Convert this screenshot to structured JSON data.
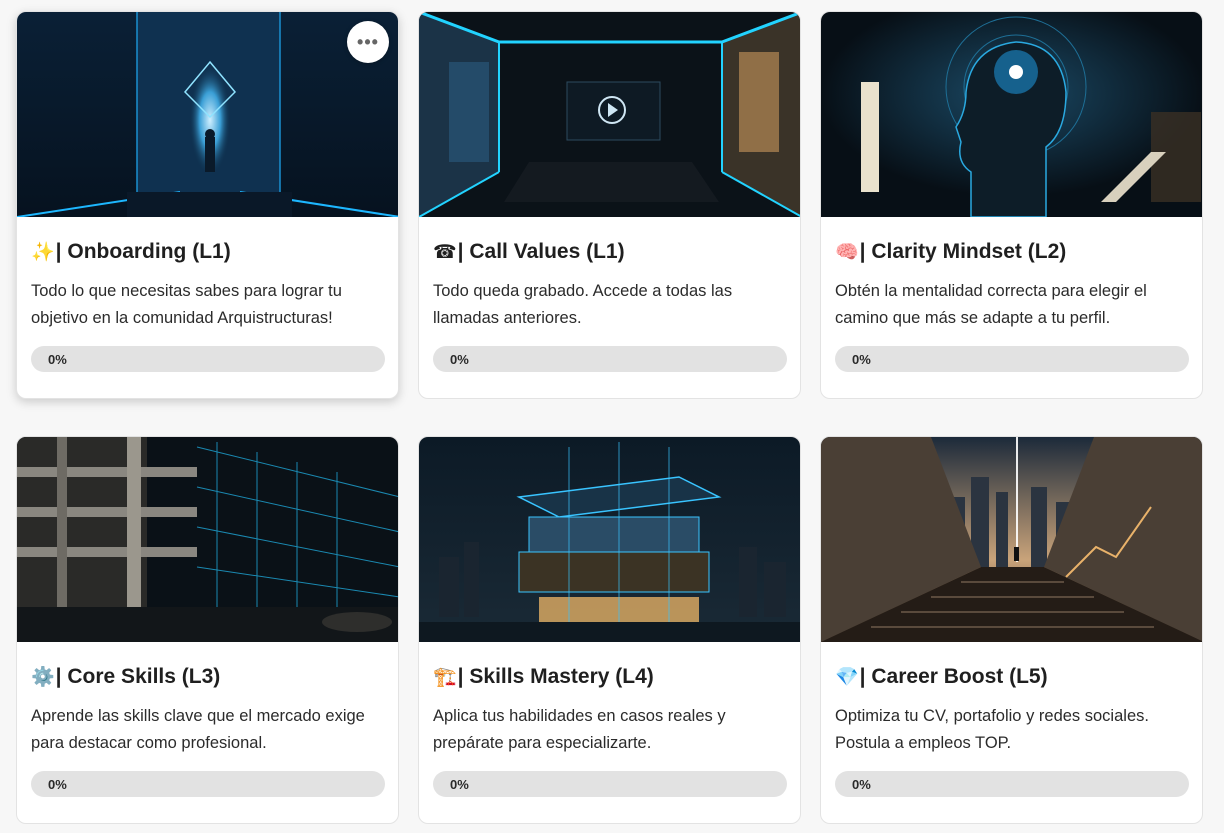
{
  "courses": [
    {
      "emoji": "✨",
      "title": "| Onboarding (L1)",
      "description": "Todo lo que necesitas sabes para lograr tu objetivo en la comunidad Arquistructuras!",
      "progress_label": "0%",
      "progress": 0,
      "image": "futuristic-corridor-figure",
      "menu_icon": "ellipsis-icon"
    },
    {
      "emoji": "☎",
      "title": "| Call Values (L1)",
      "description": "Todo queda grabado. Accede a todas las llamadas anteriores.",
      "progress_label": "0%",
      "progress": 0,
      "image": "meeting-room-play"
    },
    {
      "emoji": "🧠",
      "title": "| Clarity Mindset (L2)",
      "description": "Obtén la mentalidad correcta para elegir el camino que más se adapte a tu perfil.",
      "progress_label": "0%",
      "progress": 0,
      "image": "glowing-brain-head"
    },
    {
      "emoji": "⚙️",
      "title": "| Core Skills (L3)",
      "description": "Aprende las skills clave que el mercado exige para destacar como profesional.",
      "progress_label": "0%",
      "progress": 0,
      "image": "concrete-building-wireframe"
    },
    {
      "emoji": "🏗️",
      "title": "| Skills Mastery (L4)",
      "description": "Aplica tus habilidades en casos reales y prepárate para especializarte.",
      "progress_label": "0%",
      "progress": 0,
      "image": "glass-house-night"
    },
    {
      "emoji": "💎",
      "title": "| Career Boost (L5)",
      "description": "Optimiza tu CV, portafolio y redes sociales. Postula a empleos TOP.",
      "progress_label": "0%",
      "progress": 0,
      "image": "stairs-to-city"
    }
  ],
  "colors": {
    "progress_track": "#e2e2e2",
    "card_bg": "#ffffff",
    "page_bg": "#f7f7f7",
    "accent_glow": "#19c6ff"
  }
}
